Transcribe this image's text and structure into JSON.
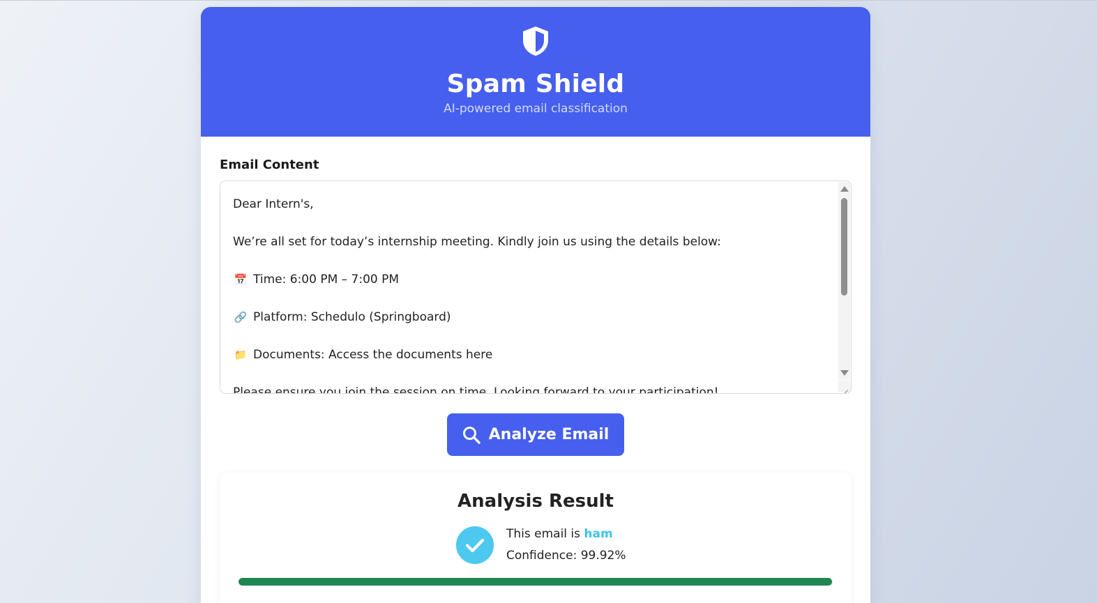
{
  "header": {
    "icon": "shield-icon",
    "title": "Spam Shield",
    "subtitle": "AI-powered email classification",
    "background_color": "#465fee"
  },
  "form": {
    "label": "Email Content",
    "email_lines": [
      {
        "emoji": "",
        "text": "Dear Intern's,"
      },
      {
        "emoji": "",
        "text": ""
      },
      {
        "emoji": "",
        "text": "We’re all set for today’s internship meeting. Kindly join us using the details below:"
      },
      {
        "emoji": "",
        "text": ""
      },
      {
        "emoji": "📅",
        "text": "Time: 6:00 PM – 7:00 PM"
      },
      {
        "emoji": "",
        "text": ""
      },
      {
        "emoji": "🔗",
        "text": "Platform: Schedulo (Springboard)"
      },
      {
        "emoji": "",
        "text": ""
      },
      {
        "emoji": "📁",
        "text": "Documents: Access the documents here"
      },
      {
        "emoji": "",
        "text": ""
      },
      {
        "emoji": "",
        "text": "Please ensure you join the session on time. Looking forward to your participation!"
      }
    ],
    "analyze_button_label": "Analyze Email",
    "analyze_button_icon": "search-icon"
  },
  "result": {
    "title": "Analysis Result",
    "icon": "check-circle-icon",
    "verdict_prefix": "This email is ",
    "verdict_value": "ham",
    "confidence_text": "Confidence: 99.92%",
    "confidence_fraction": 0.9992,
    "progress_color": "#1e8553",
    "verdict_color": "#3cc2ec"
  }
}
